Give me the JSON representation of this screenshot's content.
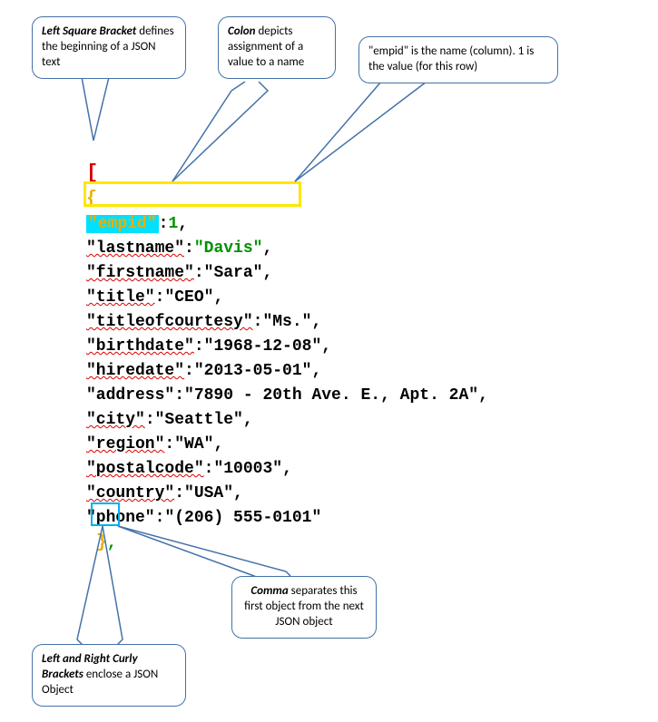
{
  "callouts": {
    "left_bracket": "Left Square Bracket",
    "left_bracket_body": " defines the beginning of a JSON text",
    "colon": "Colon",
    "colon_body": " depicts assignment of a value to a name",
    "empid_body": "\"empid\" is the name (column). 1 is the value (for this row)",
    "curly": "Left and Right Curly Brackets",
    "curly_body": " enclose a JSON Object",
    "comma": "Comma",
    "comma_body": " separates this first object from the next JSON object"
  },
  "code": {
    "bracket_open": "[",
    "brace_open": "{",
    "brace_close": "}",
    "comma_after": ",",
    "rows": [
      {
        "key_q": "\"empid\"",
        "colon": ":",
        "val": "1",
        "comma": ",",
        "is_empid": true,
        "val_num": true
      },
      {
        "key": "\"lastname\"",
        "colon": ":",
        "val": "\"Davis\"",
        "comma": ",",
        "val_green": true
      },
      {
        "key": "\"firstname\"",
        "colon": ":",
        "val": "\"Sara\"",
        "comma": ","
      },
      {
        "key": "\"title\"",
        "colon": ":",
        "val": "\"CEO\"",
        "comma": ","
      },
      {
        "key": "\"titleofcourtesy\"",
        "colon": ":",
        "val": "\"Ms.\"",
        "comma": ","
      },
      {
        "key": "\"birthdate\"",
        "colon": ":",
        "val": "\"1968-12-08\"",
        "comma": ","
      },
      {
        "key": "\"hiredate\"",
        "colon": ":",
        "val": "\"2013-05-01\"",
        "comma": ","
      },
      {
        "key": "\"address\"",
        "colon": ":",
        "val": "\"7890 - 20th Ave. E., Apt. 2A\"",
        "comma": ","
      },
      {
        "key": "\"city\"",
        "colon": ":",
        "val": "\"Seattle\"",
        "comma": ","
      },
      {
        "key": "\"region\"",
        "colon": ":",
        "val": "\"WA\"",
        "comma": ","
      },
      {
        "key": "\"postalcode\"",
        "colon": ":",
        "val": "\"10003\"",
        "comma": ","
      },
      {
        "key": "\"country\"",
        "colon": ":",
        "val": "\"USA\"",
        "comma": ","
      },
      {
        "key": "\"phone\"",
        "colon": ":",
        "val": "\"(206) 555-0101\"",
        "comma": ""
      }
    ]
  }
}
